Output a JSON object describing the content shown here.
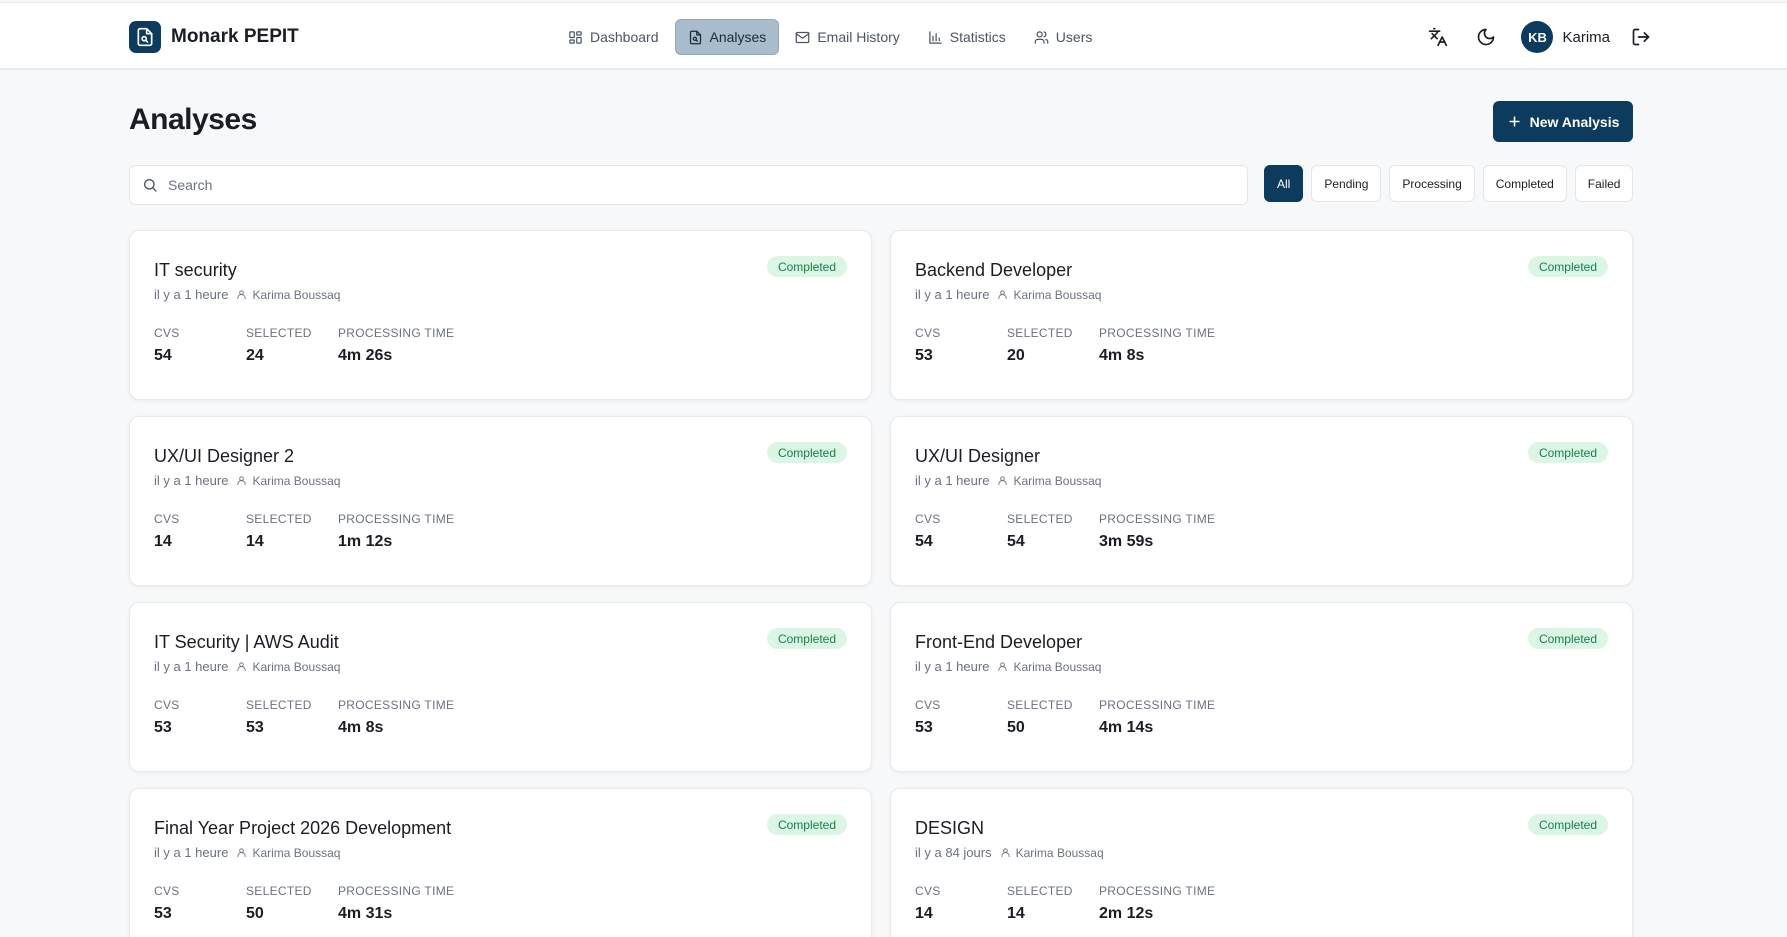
{
  "app": {
    "name": "Monark PEPIT",
    "brand_color": "#0d3b5e"
  },
  "nav": {
    "items": [
      {
        "label": "Dashboard",
        "icon": "grid-icon",
        "active": false
      },
      {
        "label": "Analyses",
        "icon": "file-search-icon",
        "active": true
      },
      {
        "label": "Email History",
        "icon": "mail-icon",
        "active": false
      },
      {
        "label": "Statistics",
        "icon": "bar-chart-icon",
        "active": false
      },
      {
        "label": "Users",
        "icon": "users-icon",
        "active": false
      }
    ]
  },
  "header_tools": {
    "translate_icon": "translate-icon",
    "theme_icon": "moon-icon",
    "logout_icon": "logout-icon"
  },
  "user": {
    "initials": "KB",
    "name": "Karima"
  },
  "page": {
    "title": "Analyses",
    "new_button_label": "New Analysis"
  },
  "search": {
    "placeholder": "Search",
    "value": ""
  },
  "filters": [
    {
      "label": "All",
      "active": true
    },
    {
      "label": "Pending",
      "active": false
    },
    {
      "label": "Processing",
      "active": false
    },
    {
      "label": "Completed",
      "active": false
    },
    {
      "label": "Failed",
      "active": false
    }
  ],
  "stat_labels": {
    "cvs": "CVS",
    "selected": "SELECTED",
    "processing_time": "PROCESSING TIME"
  },
  "analyses": [
    {
      "title": "IT security",
      "time_ago": "il y a 1 heure",
      "owner": "Karima Boussaq",
      "status": "Completed",
      "cvs": "54",
      "selected": "24",
      "processing_time": "4m 26s"
    },
    {
      "title": "Backend Developer",
      "time_ago": "il y a 1 heure",
      "owner": "Karima Boussaq",
      "status": "Completed",
      "cvs": "53",
      "selected": "20",
      "processing_time": "4m 8s"
    },
    {
      "title": "UX/UI Designer 2",
      "time_ago": "il y a 1 heure",
      "owner": "Karima Boussaq",
      "status": "Completed",
      "cvs": "14",
      "selected": "14",
      "processing_time": "1m 12s"
    },
    {
      "title": "UX/UI Designer",
      "time_ago": "il y a 1 heure",
      "owner": "Karima Boussaq",
      "status": "Completed",
      "cvs": "54",
      "selected": "54",
      "processing_time": "3m 59s"
    },
    {
      "title": "IT Security | AWS Audit",
      "time_ago": "il y a 1 heure",
      "owner": "Karima Boussaq",
      "status": "Completed",
      "cvs": "53",
      "selected": "53",
      "processing_time": "4m 8s"
    },
    {
      "title": "Front-End Developer",
      "time_ago": "il y a 1 heure",
      "owner": "Karima Boussaq",
      "status": "Completed",
      "cvs": "53",
      "selected": "50",
      "processing_time": "4m 14s"
    },
    {
      "title": "Final Year Project 2026 Development",
      "time_ago": "il y a 1 heure",
      "owner": "Karima Boussaq",
      "status": "Completed",
      "cvs": "53",
      "selected": "50",
      "processing_time": "4m 31s"
    },
    {
      "title": "DESIGN",
      "time_ago": "il y a 84 jours",
      "owner": "Karima Boussaq",
      "status": "Completed",
      "cvs": "14",
      "selected": "14",
      "processing_time": "2m 12s"
    }
  ]
}
